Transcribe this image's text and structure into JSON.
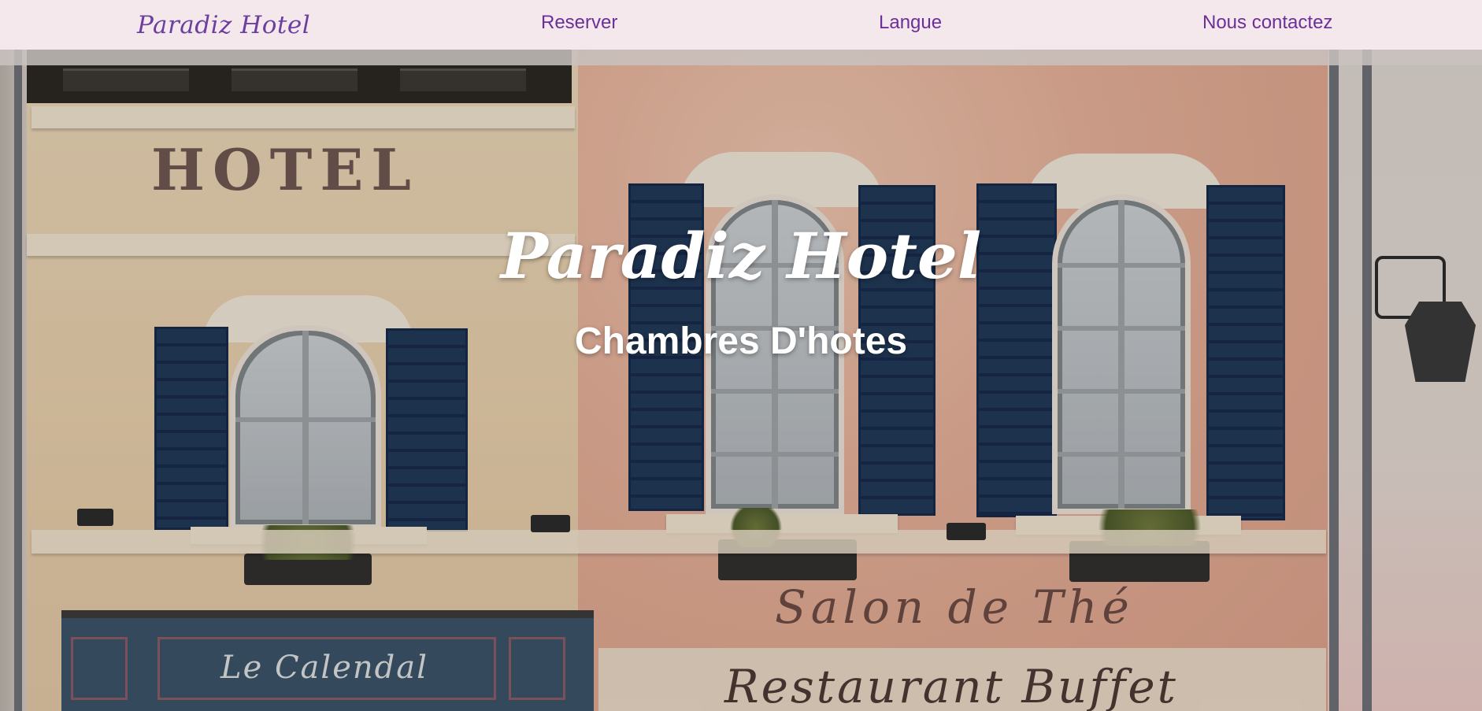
{
  "nav": {
    "brand": "Paradiz Hotel",
    "links": [
      {
        "label": "Reserver"
      },
      {
        "label": "Langue"
      },
      {
        "label": "Nous contactez"
      }
    ]
  },
  "hero": {
    "title": "Paradiz Hotel",
    "subtitle": "Chambres D'hotes"
  },
  "background_signage": {
    "hotel": "HOTEL",
    "store": "Le Calendal",
    "salon": "Salon de Thé",
    "restaurant": "Restaurant Buffet"
  },
  "colors": {
    "nav_background": "#f4e8ec",
    "nav_text": "#6b2f9a",
    "hero_text": "#ffffff",
    "shutters": "#1f3856"
  }
}
